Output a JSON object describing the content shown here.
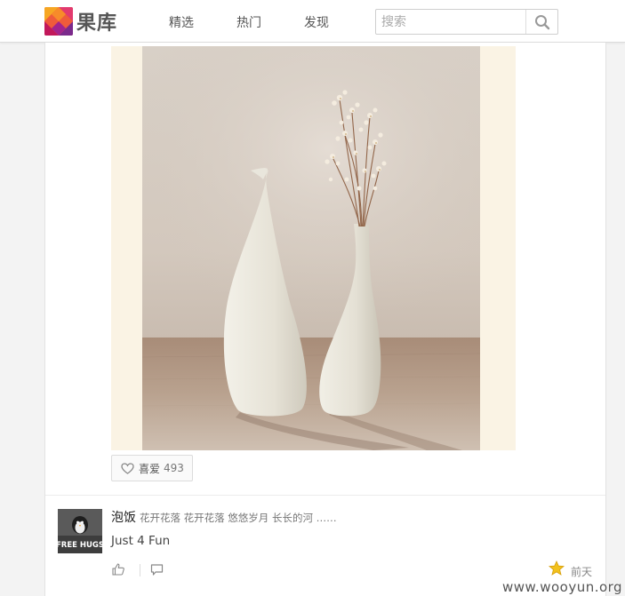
{
  "app": {
    "logo_text": "果库"
  },
  "nav": {
    "items": [
      {
        "label": "精选"
      },
      {
        "label": "热门"
      },
      {
        "label": "发现"
      }
    ]
  },
  "search": {
    "placeholder": "搜索",
    "value": ""
  },
  "post": {
    "like_label": "喜爱",
    "like_count": "493",
    "author": "泡饭",
    "author_bio": "花开花落 花开花落 悠悠岁月 长长的河 ……",
    "text": "Just 4 Fun",
    "time": "前天"
  },
  "avatar": {
    "caption": "FREE HUGS"
  },
  "watermark": "www.wooyun.org",
  "colors": {
    "accent_star": "#f2c11c",
    "photo_background": "#faf3e4"
  },
  "icons": {
    "search": "search-icon",
    "heart": "heart-icon",
    "thumb": "thumbs-up-icon",
    "comment": "comment-icon",
    "star": "star-icon"
  }
}
